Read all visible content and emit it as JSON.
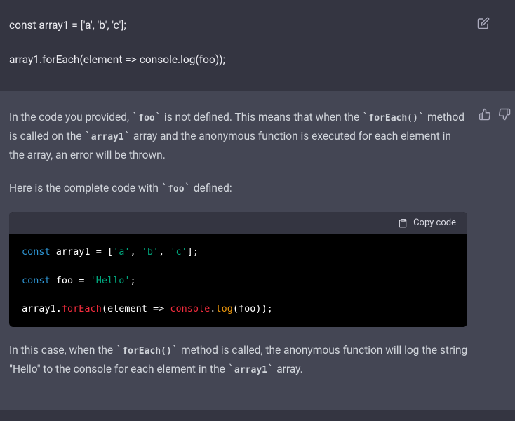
{
  "user": {
    "line1": "const array1 = ['a', 'b', 'c'];",
    "line2": "array1.forEach(element => console.log(foo));"
  },
  "assistant": {
    "p1_prefix": "In the code you provided, ",
    "code_foo": "foo",
    "p1_mid1": " is not defined. This means that when the ",
    "code_foreach": "forEach()",
    "p1_mid2": " method is called on the ",
    "code_array1": "array1",
    "p1_end": " array and the anonymous function is executed for each element in the array, an error will be thrown.",
    "p2_prefix": "Here is the complete code with ",
    "p2_end": " defined:",
    "p3_prefix": "In this case, when the ",
    "p3_mid": " method is called, the anonymous function will log the string \"Hello\" to the console for each element in the ",
    "p3_end": " array."
  },
  "codeblock": {
    "copy_label": "Copy code",
    "tokens": {
      "const": "const",
      "array1": "array1",
      "eq": " = ",
      "lbracket": "[",
      "a": "'a'",
      "comma": ", ",
      "b": "'b'",
      "c": "'c'",
      "rbracket_semi": "];",
      "foo": "foo",
      "hello": "'Hello'",
      "semi": ";",
      "dot": ".",
      "forEach": "forEach",
      "lparen": "(",
      "element": "element",
      "arrow": " => ",
      "console": "console",
      "log": "log",
      "rparen2_semi": "));"
    }
  }
}
